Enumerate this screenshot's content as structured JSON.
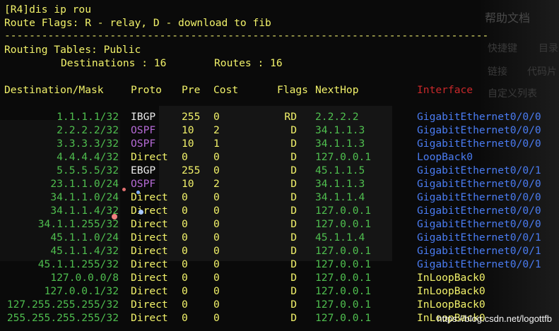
{
  "terminal": {
    "prompt_line": "[R4]dis ip rou",
    "flags_line": "Route Flags: R - relay, D - download to fib",
    "separator": "------------------------------------------------------------------------------",
    "routing_tables": "Routing Tables: Public",
    "destinations_label": "Destinations : 16",
    "routes_label": "Routes : 16",
    "headers": {
      "destination": "Destination/Mask",
      "proto": "Proto",
      "pre": "Pre",
      "cost": "Cost",
      "flags": "Flags",
      "nexthop": "NextHop",
      "interface": "Interface"
    },
    "rows": [
      {
        "destination": "1.1.1.1/32",
        "proto": "IBGP",
        "pre": "255",
        "cost": "0",
        "flags": "RD",
        "nexthop": "2.2.2.2",
        "interface": "GigabitEthernet0/0/0"
      },
      {
        "destination": "2.2.2.2/32",
        "proto": "OSPF",
        "pre": "10",
        "cost": "2",
        "flags": "D",
        "nexthop": "34.1.1.3",
        "interface": "GigabitEthernet0/0/0"
      },
      {
        "destination": "3.3.3.3/32",
        "proto": "OSPF",
        "pre": "10",
        "cost": "1",
        "flags": "D",
        "nexthop": "34.1.1.3",
        "interface": "GigabitEthernet0/0/0"
      },
      {
        "destination": "4.4.4.4/32",
        "proto": "Direct",
        "pre": "0",
        "cost": "0",
        "flags": "D",
        "nexthop": "127.0.0.1",
        "interface": "LoopBack0"
      },
      {
        "destination": "5.5.5.5/32",
        "proto": "EBGP",
        "pre": "255",
        "cost": "0",
        "flags": "D",
        "nexthop": "45.1.1.5",
        "interface": "GigabitEthernet0/0/1"
      },
      {
        "destination": "23.1.1.0/24",
        "proto": "OSPF",
        "pre": "10",
        "cost": "2",
        "flags": "D",
        "nexthop": "34.1.1.3",
        "interface": "GigabitEthernet0/0/0"
      },
      {
        "destination": "34.1.1.0/24",
        "proto": "Direct",
        "pre": "0",
        "cost": "0",
        "flags": "D",
        "nexthop": "34.1.1.4",
        "interface": "GigabitEthernet0/0/0"
      },
      {
        "destination": "34.1.1.4/32",
        "proto": "Direct",
        "pre": "0",
        "cost": "0",
        "flags": "D",
        "nexthop": "127.0.0.1",
        "interface": "GigabitEthernet0/0/0"
      },
      {
        "destination": "34.1.1.255/32",
        "proto": "Direct",
        "pre": "0",
        "cost": "0",
        "flags": "D",
        "nexthop": "127.0.0.1",
        "interface": "GigabitEthernet0/0/0"
      },
      {
        "destination": "45.1.1.0/24",
        "proto": "Direct",
        "pre": "0",
        "cost": "0",
        "flags": "D",
        "nexthop": "45.1.1.4",
        "interface": "GigabitEthernet0/0/1"
      },
      {
        "destination": "45.1.1.4/32",
        "proto": "Direct",
        "pre": "0",
        "cost": "0",
        "flags": "D",
        "nexthop": "127.0.0.1",
        "interface": "GigabitEthernet0/0/1"
      },
      {
        "destination": "45.1.1.255/32",
        "proto": "Direct",
        "pre": "0",
        "cost": "0",
        "flags": "D",
        "nexthop": "127.0.0.1",
        "interface": "GigabitEthernet0/0/1"
      },
      {
        "destination": "127.0.0.0/8",
        "proto": "Direct",
        "pre": "0",
        "cost": "0",
        "flags": "D",
        "nexthop": "127.0.0.1",
        "interface": "InLoopBack0"
      },
      {
        "destination": "127.0.0.1/32",
        "proto": "Direct",
        "pre": "0",
        "cost": "0",
        "flags": "D",
        "nexthop": "127.0.0.1",
        "interface": "InLoopBack0"
      },
      {
        "destination": "127.255.255.255/32",
        "proto": "Direct",
        "pre": "0",
        "cost": "0",
        "flags": "D",
        "nexthop": "127.0.0.1",
        "interface": "InLoopBack0"
      },
      {
        "destination": "255.255.255.255/32",
        "proto": "Direct",
        "pre": "0",
        "cost": "0",
        "flags": "D",
        "nexthop": "127.0.0.1",
        "interface": "InLoopBack0"
      }
    ]
  },
  "background": {
    "help_title": "帮助文档",
    "items": [
      "快捷键",
      "目录",
      "链接",
      "代码片",
      "自定义列表"
    ],
    "watermark": "https://blog.csdn.net/logottfb"
  },
  "colors": {
    "proto": {
      "IBGP": "#eaeaea",
      "OSPF": "#b56ad6",
      "Direct": "#f2f26a",
      "EBGP": "#eaeaea"
    },
    "destination": "#4fbf4f",
    "interface": "#4a7cf2",
    "interface_loopback": "#f2f26a",
    "interface_header": "#c8282a"
  }
}
